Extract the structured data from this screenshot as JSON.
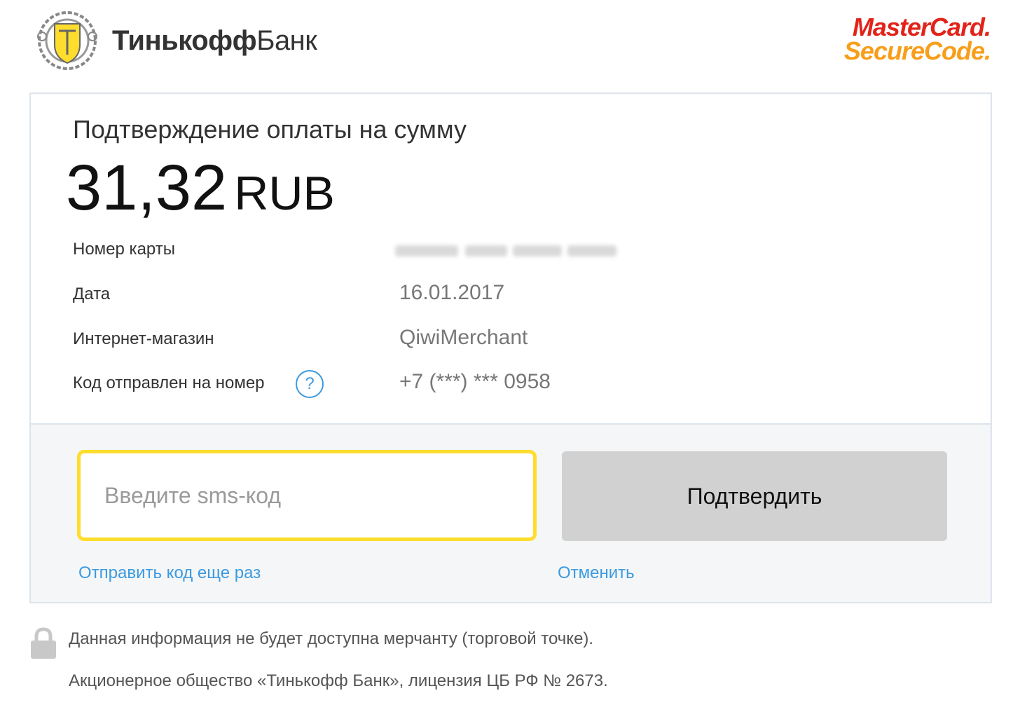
{
  "header": {
    "bank_name_bold": "Тинькофф",
    "bank_name_light": "Банк",
    "mc_line1": "MasterCard.",
    "mc_line2": "SecureCode."
  },
  "payment": {
    "title": "Подтверждение оплаты на сумму",
    "amount": "31,32",
    "currency": "RUB",
    "rows": [
      {
        "label": "Номер карты",
        "value": ""
      },
      {
        "label": "Дата",
        "value": "16.01.2017"
      },
      {
        "label": "Интернет-магазин",
        "value": "QiwiMerchant"
      },
      {
        "label": "Код отправлен на номер",
        "value": "+7 (***) *** 0958"
      }
    ],
    "help_glyph": "?"
  },
  "form": {
    "sms_placeholder": "Введите sms-код",
    "confirm_label": "Подтвердить",
    "resend_label": "Отправить код еще раз",
    "cancel_label": "Отменить"
  },
  "footer": {
    "note": "Данная информация не будет доступна мерчанту (торговой точке).",
    "legal": "Акционерное общество «Тинькофф Банк», лицензия ЦБ РФ № 2673."
  },
  "colors": {
    "accent_yellow": "#ffdd2d",
    "link_blue": "#3b9ae1",
    "mc_red": "#e2231a",
    "mc_orange": "#f79e1b"
  },
  "icons": {
    "bank_logo": "tinkoff-crest-icon",
    "help": "question-circle-icon",
    "lock": "lock-icon"
  }
}
